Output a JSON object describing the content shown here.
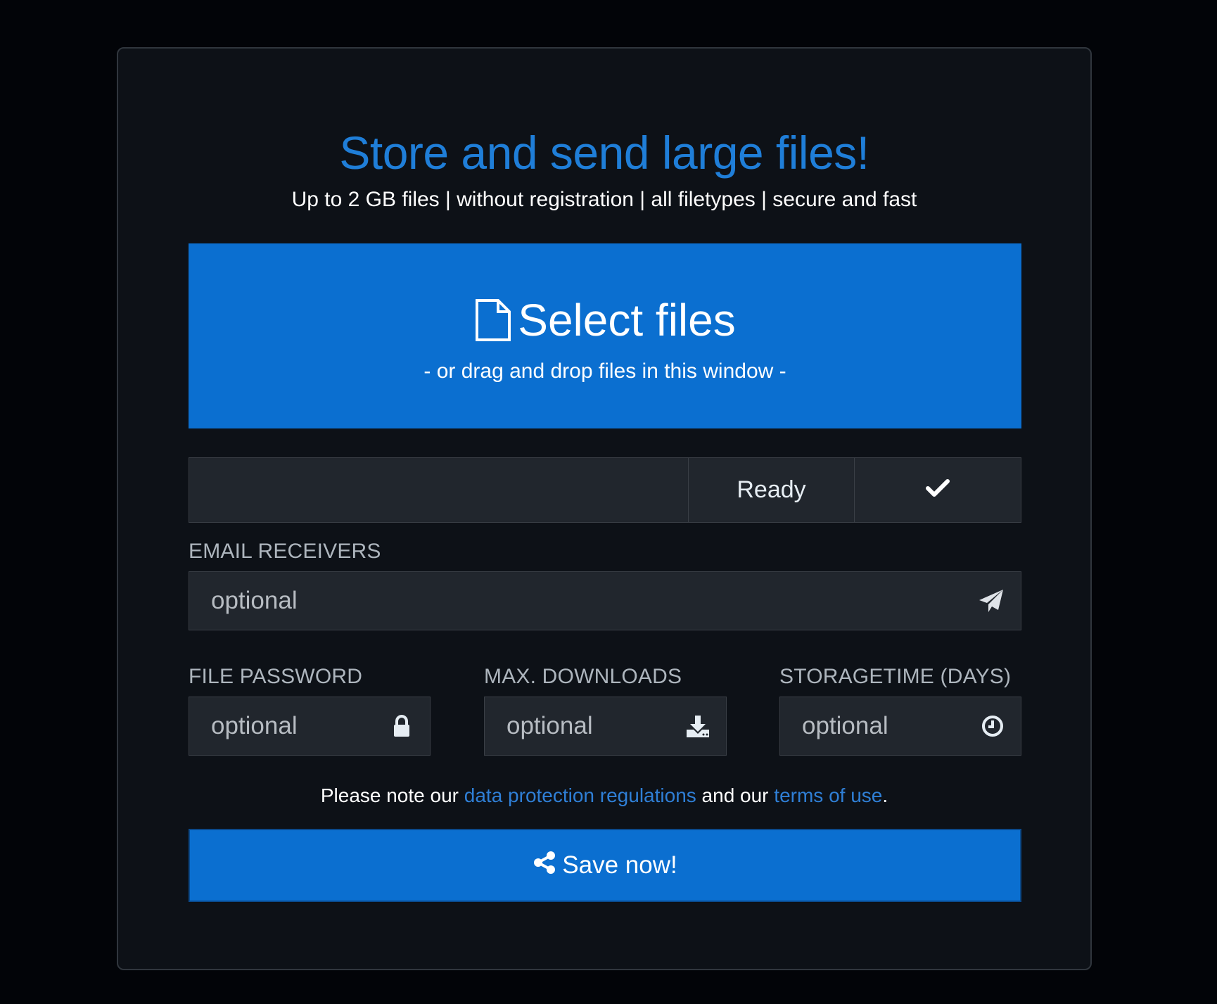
{
  "header": {
    "title": "Store and send large files!",
    "subtitle": "Up to 2 GB files | without registration | all filetypes | secure and fast"
  },
  "dropzone": {
    "icon": "file-icon",
    "label": "Select files",
    "hint": "- or drag and drop files in this window -"
  },
  "status": {
    "text": "Ready",
    "icon": "checkmark-icon"
  },
  "email": {
    "label": "EMAIL RECEIVERS",
    "placeholder": "optional",
    "icon": "paper-plane-icon"
  },
  "password": {
    "label": "FILE PASSWORD",
    "placeholder": "optional",
    "icon": "lock-icon"
  },
  "max_downloads": {
    "label": "MAX. DOWNLOADS",
    "placeholder": "optional",
    "icon": "download-icon"
  },
  "storagetime": {
    "label": "STORAGETIME (DAYS)",
    "placeholder": "optional",
    "icon": "clock-icon"
  },
  "note": {
    "prefix": "Please note our ",
    "link1": "data protection regulations",
    "middle": " and our ",
    "link2": "terms of use",
    "suffix": "."
  },
  "save_button": {
    "label": "Save now!",
    "icon": "share-icon"
  },
  "colors": {
    "page_background": "#020408",
    "card_background": "#0d1117",
    "accent_blue": "#0b6fd0",
    "title_blue": "#1f7ed8",
    "link_blue": "#2f7fd6",
    "field_background": "#21262d",
    "label_gray": "#adb5bd"
  }
}
